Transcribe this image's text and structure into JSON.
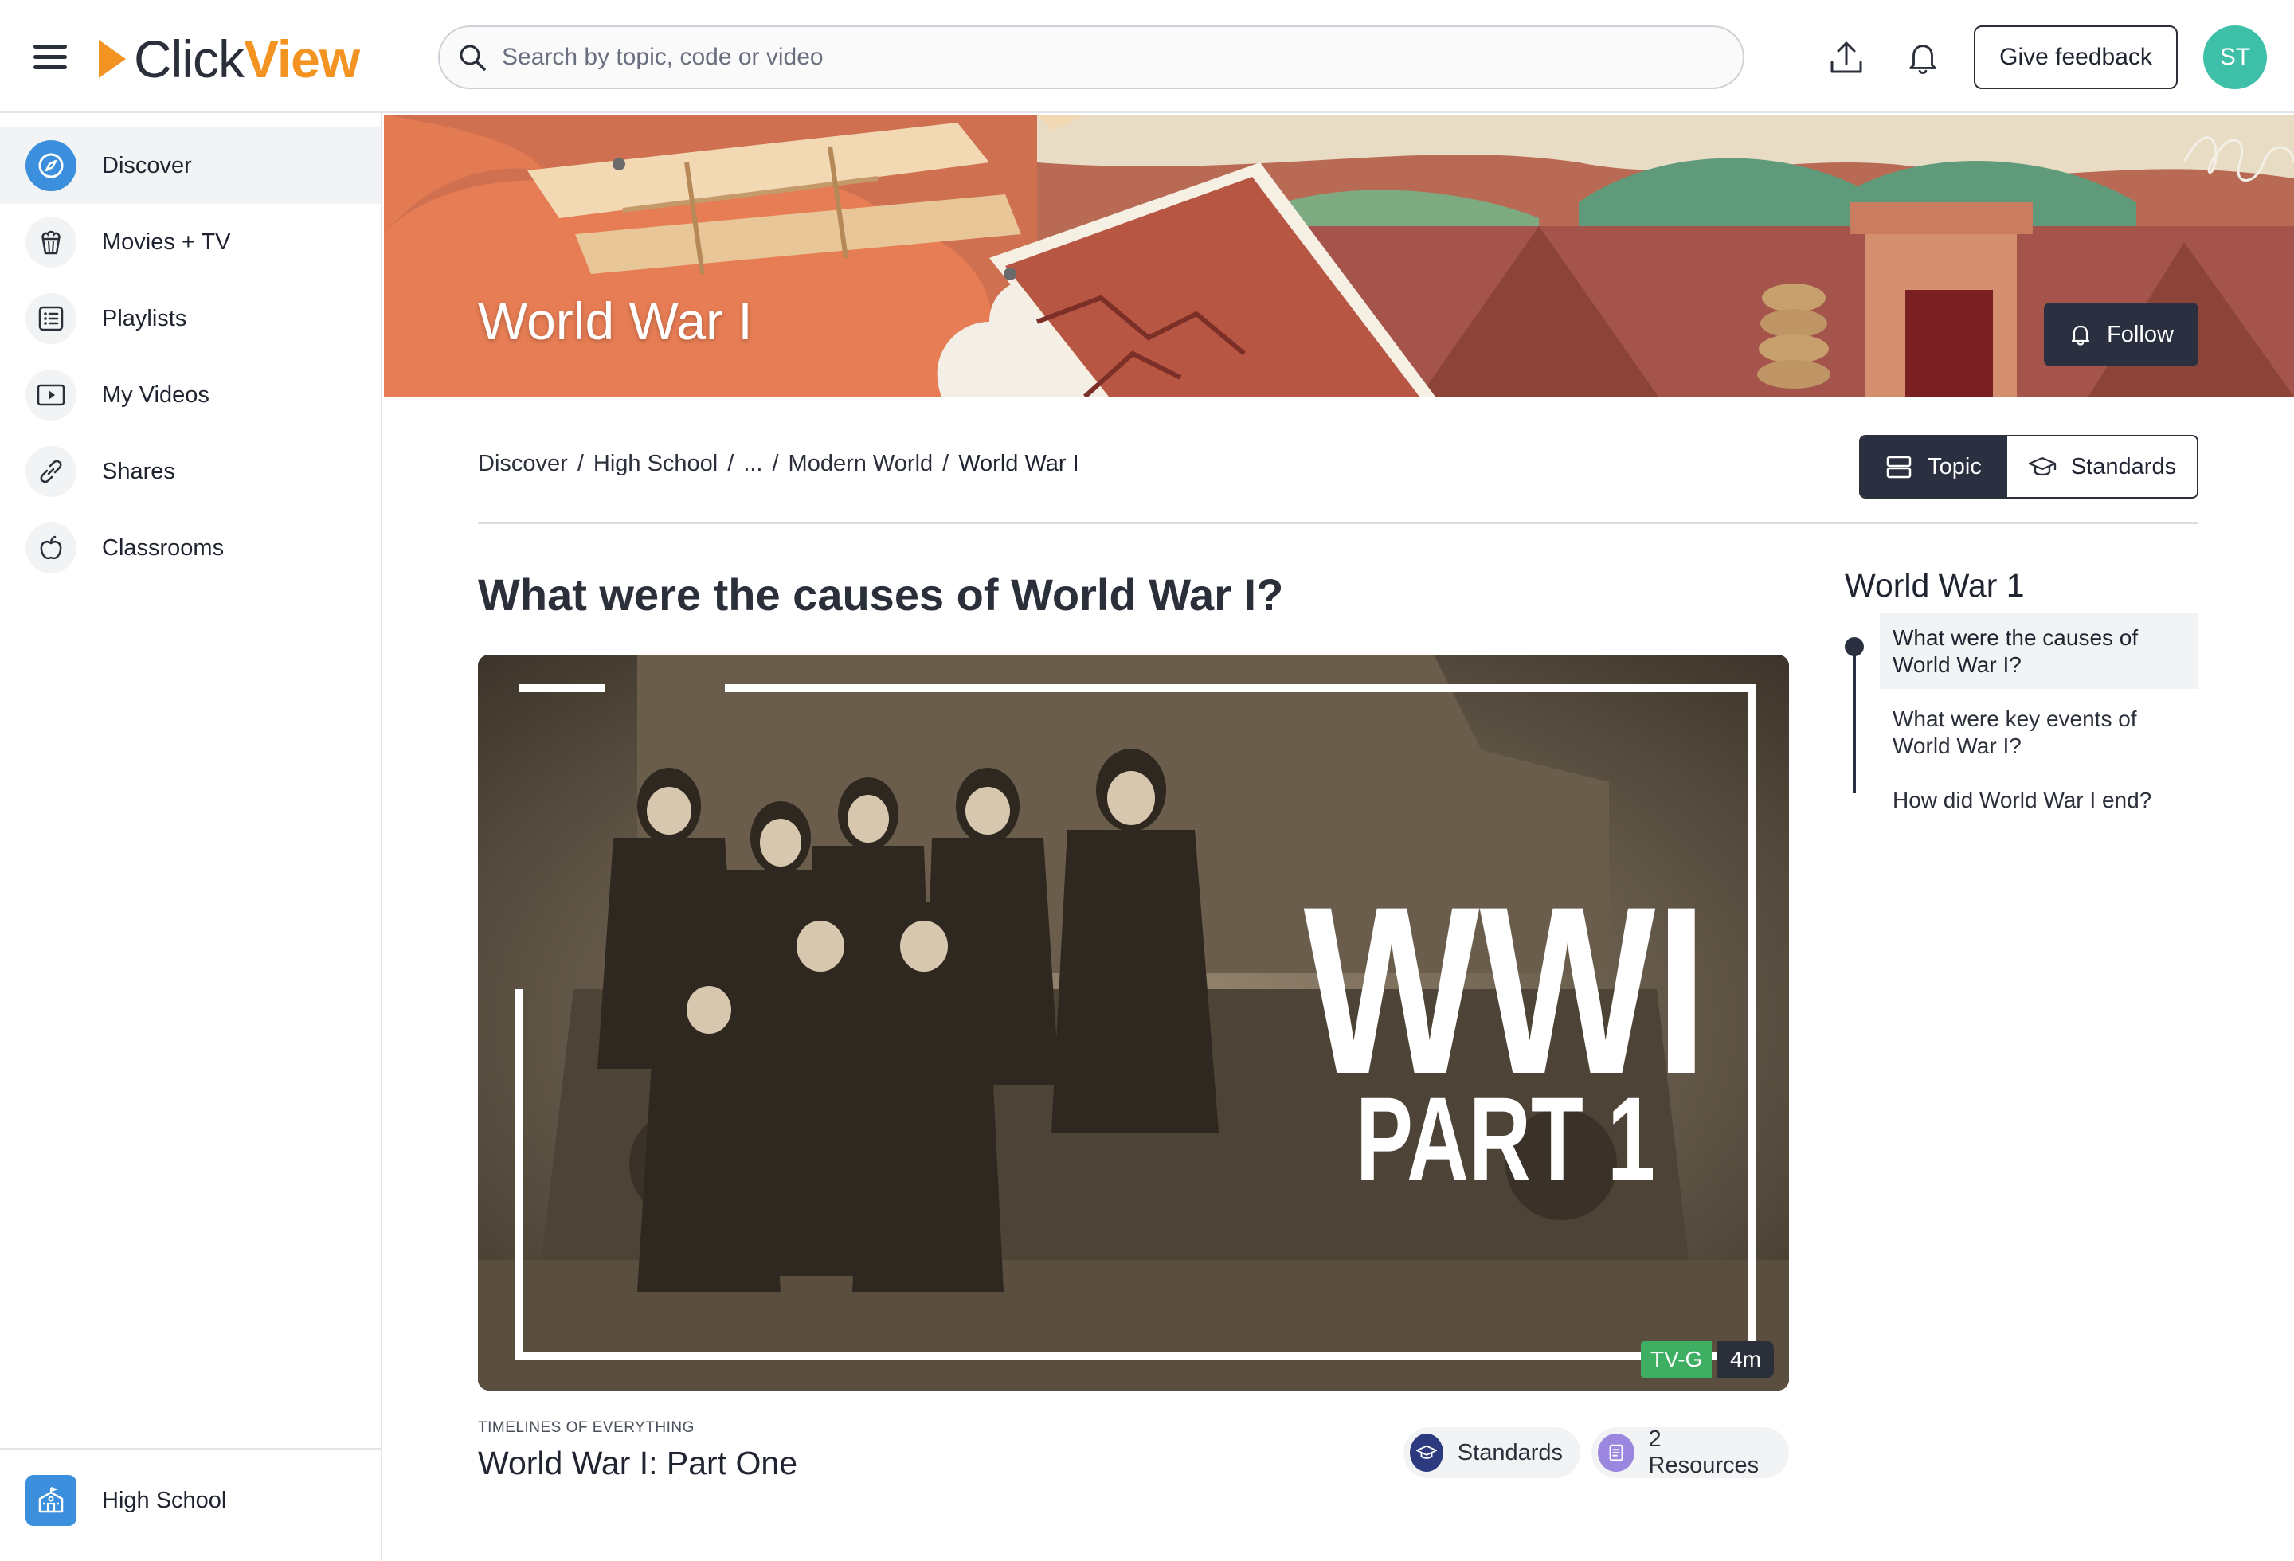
{
  "header": {
    "logo_click": "Click",
    "logo_view": "View",
    "search_placeholder": "Search by topic, code or video",
    "feedback_label": "Give feedback",
    "avatar_initials": "ST"
  },
  "sidebar": {
    "items": [
      {
        "label": "Discover",
        "icon": "compass-icon"
      },
      {
        "label": "Movies + TV",
        "icon": "popcorn-icon"
      },
      {
        "label": "Playlists",
        "icon": "list-icon"
      },
      {
        "label": "My Videos",
        "icon": "play-icon"
      },
      {
        "label": "Shares",
        "icon": "link-icon"
      },
      {
        "label": "Classrooms",
        "icon": "apple-icon"
      }
    ],
    "school_label": "High School"
  },
  "banner": {
    "title": "World War I",
    "follow_label": "Follow"
  },
  "breadcrumb": {
    "items": [
      "Discover",
      "High School",
      "...",
      "Modern World"
    ],
    "current": "World War I",
    "separator": "/"
  },
  "view_toggle": {
    "topic_label": "Topic",
    "standards_label": "Standards",
    "selected": "Topic"
  },
  "main": {
    "question": "What were the causes of World War I?",
    "video": {
      "thumbnail_text_main": "WWI",
      "thumbnail_text_sub": "PART 1",
      "rating": "TV-G",
      "duration": "4m",
      "series": "TIMELINES OF EVERYTHING",
      "title": "World War I: Part One",
      "standards_label": "Standards",
      "resources_label": "2 Resources"
    }
  },
  "toc": {
    "title": "World War 1",
    "items": [
      "What were the causes of World War I?",
      "What were key events of World War I?",
      "How did World War I end?"
    ],
    "active_index": 0
  },
  "colors": {
    "accent_orange": "#f39322",
    "nav_active_blue": "#3b8fdc",
    "avatar_teal": "#3dbfa8",
    "dark_button": "#2a3040",
    "rating_green": "#3eae62"
  }
}
